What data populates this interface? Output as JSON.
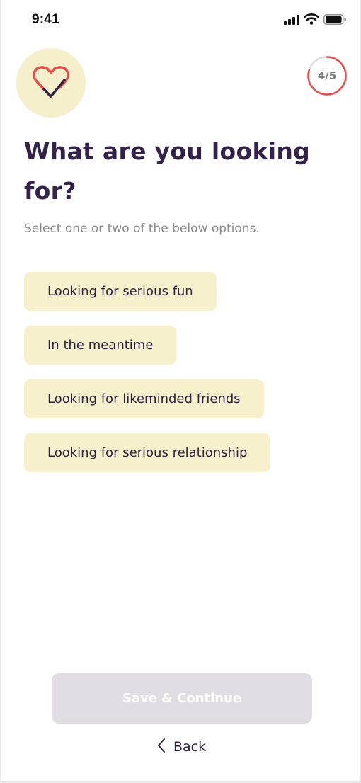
{
  "status_bar": {
    "time": "9:41",
    "icons": [
      "cellular-signal-icon",
      "wifi-icon",
      "battery-icon"
    ]
  },
  "logo": {
    "icon": "heart-check-icon",
    "colors": {
      "heart": "#ef4747",
      "check": "#2e2240",
      "background": "#f5efcc"
    }
  },
  "progress": {
    "label": "4/5",
    "current": 4,
    "total": 5,
    "ring_color": "#ef4747"
  },
  "heading": "What are you looking for?",
  "subtitle": "Select one or two of the below options.",
  "options": [
    {
      "label": "Looking for serious fun"
    },
    {
      "label": "In the meantime"
    },
    {
      "label": "Looking for likeminded friends"
    },
    {
      "label": "Looking for serious relationship"
    }
  ],
  "footer": {
    "save_label": "Save & Continue",
    "back_label": "Back",
    "back_icon": "chevron-left-icon"
  },
  "colors": {
    "accent": "#33224a",
    "option_bg": "#f6f0cc",
    "disabled_button": "#e0dee2"
  }
}
